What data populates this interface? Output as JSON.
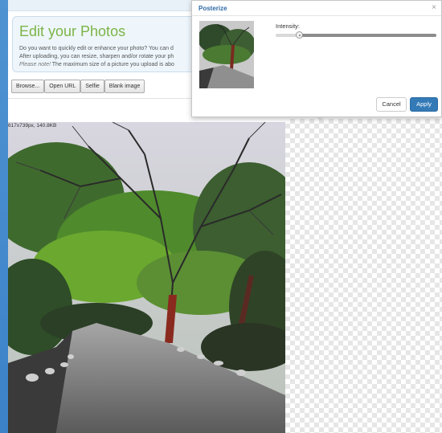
{
  "header": {
    "title": "Edit your Photos",
    "line1": "Do you want to quickly edit or enhance your photo? You can d",
    "line2": "After uploading, you can resize, sharpen and/or rotate your ph",
    "line3_em": "Please note!",
    "line3_rest": " The maximum size of a picture you upload is abo"
  },
  "toolbar": {
    "browse": "Browse...",
    "open_url": "Open URL",
    "selfie": "Selfie",
    "blank_image": "Blank image"
  },
  "image_info": "617x739px, 140.8KB",
  "dialog": {
    "title": "Posterize",
    "close": "×",
    "intensity_label": "Intensity:",
    "intensity_value": 0.15,
    "cancel": "Cancel",
    "apply": "Apply"
  },
  "colors": {
    "title_green": "#7cb445",
    "dialog_title_blue": "#2f6aa6",
    "apply_blue": "#337ab7",
    "frame_blue": "#4f93d2"
  }
}
